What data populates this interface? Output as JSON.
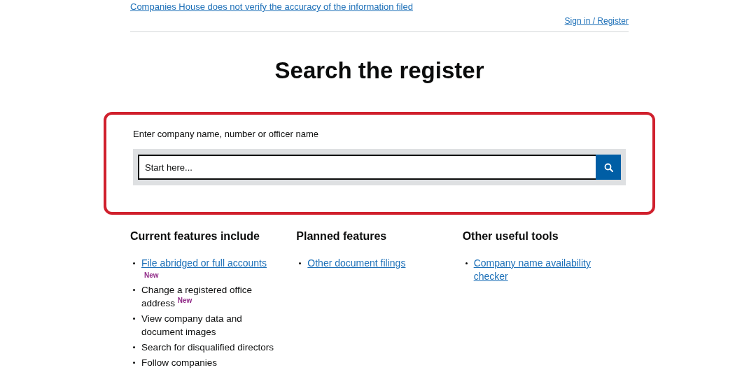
{
  "notice_link": "Companies House does not verify the accuracy of the information filed",
  "account_link": "Sign in / Register",
  "title": "Search the register",
  "search": {
    "label": "Enter company name, number or officer name",
    "placeholder": "Start here...",
    "highlighted": true
  },
  "columns": [
    {
      "heading": "Current features include",
      "items": [
        {
          "kind": "link",
          "text": "File abridged or full accounts",
          "badge": "New"
        },
        {
          "kind": "text",
          "text": "Change a registered office address $^{New}$"
        },
        {
          "kind": "text",
          "text": "View company data and document images"
        },
        {
          "kind": "text",
          "text": "Search for disqualified directors"
        },
        {
          "kind": "text",
          "text": "Follow companies"
        }
      ]
    },
    {
      "heading": "Planned features",
      "items": [
        {
          "kind": "link",
          "text": "Other document filings"
        }
      ]
    },
    {
      "heading": "Other useful tools",
      "items": [
        {
          "kind": "link",
          "text": "Company name availability checker"
        }
      ]
    }
  ]
}
